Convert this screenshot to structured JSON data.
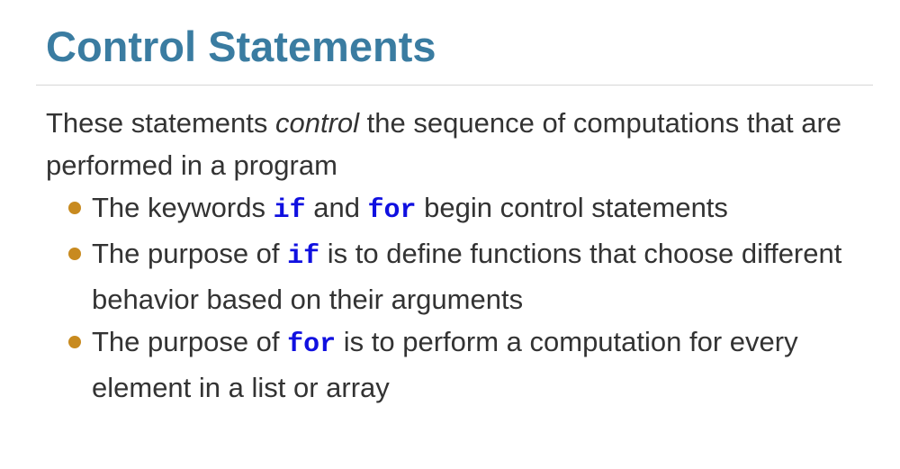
{
  "slide": {
    "title": "Control Statements",
    "intro": {
      "before": "These statements ",
      "emphasis": "control",
      "after": " the sequence of computations that are performed in a program"
    },
    "bullets": [
      {
        "t1": "The keywords ",
        "code1": "if",
        "t2": " and ",
        "code2": "for",
        "t3": " begin control statements"
      },
      {
        "t1": "The purpose of ",
        "code1": "if",
        "t2": " is to define functions that choose different behavior based on their arguments"
      },
      {
        "t1": "The purpose of ",
        "code1": "for",
        "t2": " is to perform a computation for every element in a list or array"
      }
    ],
    "colors": {
      "title": "#3a7ca1",
      "text": "#333333",
      "bullet": "#c88a1f",
      "code": "#1010e0",
      "rule": "#d7d7d7"
    }
  }
}
